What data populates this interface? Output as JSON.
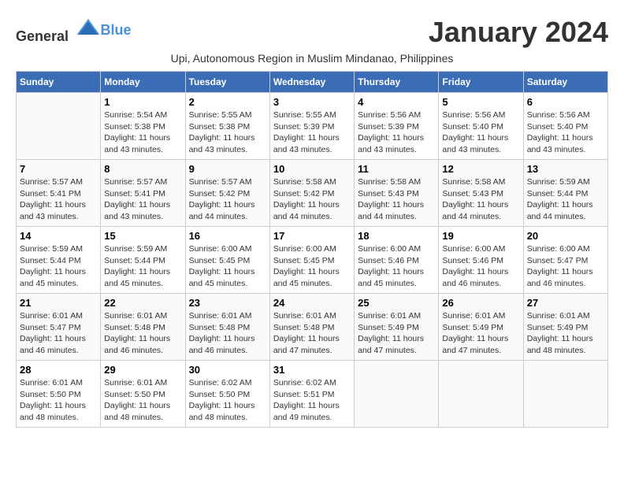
{
  "app": {
    "logo_general": "General",
    "logo_blue": "Blue"
  },
  "header": {
    "month_title": "January 2024",
    "subtitle": "Upi, Autonomous Region in Muslim Mindanao, Philippines"
  },
  "days_of_week": [
    "Sunday",
    "Monday",
    "Tuesday",
    "Wednesday",
    "Thursday",
    "Friday",
    "Saturday"
  ],
  "weeks": [
    [
      {
        "day": "",
        "info": ""
      },
      {
        "day": "1",
        "info": "Sunrise: 5:54 AM\nSunset: 5:38 PM\nDaylight: 11 hours\nand 43 minutes."
      },
      {
        "day": "2",
        "info": "Sunrise: 5:55 AM\nSunset: 5:38 PM\nDaylight: 11 hours\nand 43 minutes."
      },
      {
        "day": "3",
        "info": "Sunrise: 5:55 AM\nSunset: 5:39 PM\nDaylight: 11 hours\nand 43 minutes."
      },
      {
        "day": "4",
        "info": "Sunrise: 5:56 AM\nSunset: 5:39 PM\nDaylight: 11 hours\nand 43 minutes."
      },
      {
        "day": "5",
        "info": "Sunrise: 5:56 AM\nSunset: 5:40 PM\nDaylight: 11 hours\nand 43 minutes."
      },
      {
        "day": "6",
        "info": "Sunrise: 5:56 AM\nSunset: 5:40 PM\nDaylight: 11 hours\nand 43 minutes."
      }
    ],
    [
      {
        "day": "7",
        "info": "Sunrise: 5:57 AM\nSunset: 5:41 PM\nDaylight: 11 hours\nand 43 minutes."
      },
      {
        "day": "8",
        "info": "Sunrise: 5:57 AM\nSunset: 5:41 PM\nDaylight: 11 hours\nand 43 minutes."
      },
      {
        "day": "9",
        "info": "Sunrise: 5:57 AM\nSunset: 5:42 PM\nDaylight: 11 hours\nand 44 minutes."
      },
      {
        "day": "10",
        "info": "Sunrise: 5:58 AM\nSunset: 5:42 PM\nDaylight: 11 hours\nand 44 minutes."
      },
      {
        "day": "11",
        "info": "Sunrise: 5:58 AM\nSunset: 5:43 PM\nDaylight: 11 hours\nand 44 minutes."
      },
      {
        "day": "12",
        "info": "Sunrise: 5:58 AM\nSunset: 5:43 PM\nDaylight: 11 hours\nand 44 minutes."
      },
      {
        "day": "13",
        "info": "Sunrise: 5:59 AM\nSunset: 5:44 PM\nDaylight: 11 hours\nand 44 minutes."
      }
    ],
    [
      {
        "day": "14",
        "info": "Sunrise: 5:59 AM\nSunset: 5:44 PM\nDaylight: 11 hours\nand 45 minutes."
      },
      {
        "day": "15",
        "info": "Sunrise: 5:59 AM\nSunset: 5:44 PM\nDaylight: 11 hours\nand 45 minutes."
      },
      {
        "day": "16",
        "info": "Sunrise: 6:00 AM\nSunset: 5:45 PM\nDaylight: 11 hours\nand 45 minutes."
      },
      {
        "day": "17",
        "info": "Sunrise: 6:00 AM\nSunset: 5:45 PM\nDaylight: 11 hours\nand 45 minutes."
      },
      {
        "day": "18",
        "info": "Sunrise: 6:00 AM\nSunset: 5:46 PM\nDaylight: 11 hours\nand 45 minutes."
      },
      {
        "day": "19",
        "info": "Sunrise: 6:00 AM\nSunset: 5:46 PM\nDaylight: 11 hours\nand 46 minutes."
      },
      {
        "day": "20",
        "info": "Sunrise: 6:00 AM\nSunset: 5:47 PM\nDaylight: 11 hours\nand 46 minutes."
      }
    ],
    [
      {
        "day": "21",
        "info": "Sunrise: 6:01 AM\nSunset: 5:47 PM\nDaylight: 11 hours\nand 46 minutes."
      },
      {
        "day": "22",
        "info": "Sunrise: 6:01 AM\nSunset: 5:48 PM\nDaylight: 11 hours\nand 46 minutes."
      },
      {
        "day": "23",
        "info": "Sunrise: 6:01 AM\nSunset: 5:48 PM\nDaylight: 11 hours\nand 46 minutes."
      },
      {
        "day": "24",
        "info": "Sunrise: 6:01 AM\nSunset: 5:48 PM\nDaylight: 11 hours\nand 47 minutes."
      },
      {
        "day": "25",
        "info": "Sunrise: 6:01 AM\nSunset: 5:49 PM\nDaylight: 11 hours\nand 47 minutes."
      },
      {
        "day": "26",
        "info": "Sunrise: 6:01 AM\nSunset: 5:49 PM\nDaylight: 11 hours\nand 47 minutes."
      },
      {
        "day": "27",
        "info": "Sunrise: 6:01 AM\nSunset: 5:49 PM\nDaylight: 11 hours\nand 48 minutes."
      }
    ],
    [
      {
        "day": "28",
        "info": "Sunrise: 6:01 AM\nSunset: 5:50 PM\nDaylight: 11 hours\nand 48 minutes."
      },
      {
        "day": "29",
        "info": "Sunrise: 6:01 AM\nSunset: 5:50 PM\nDaylight: 11 hours\nand 48 minutes."
      },
      {
        "day": "30",
        "info": "Sunrise: 6:02 AM\nSunset: 5:50 PM\nDaylight: 11 hours\nand 48 minutes."
      },
      {
        "day": "31",
        "info": "Sunrise: 6:02 AM\nSunset: 5:51 PM\nDaylight: 11 hours\nand 49 minutes."
      },
      {
        "day": "",
        "info": ""
      },
      {
        "day": "",
        "info": ""
      },
      {
        "day": "",
        "info": ""
      }
    ]
  ]
}
